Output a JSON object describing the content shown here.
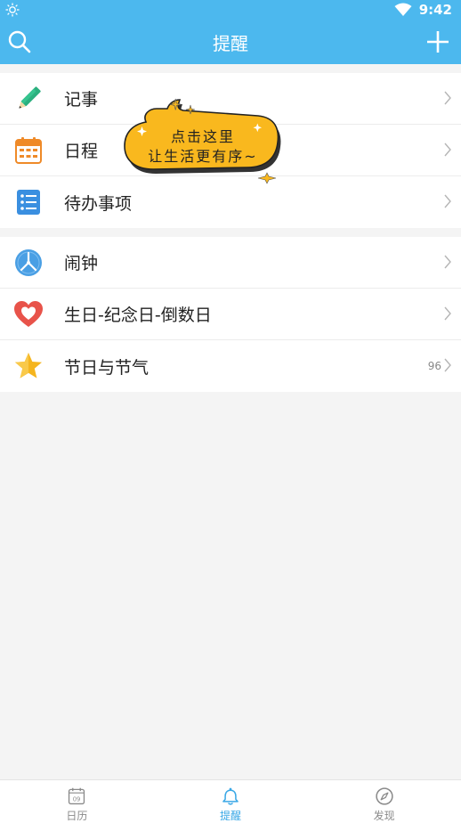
{
  "status_bar": {
    "time": "9:42"
  },
  "header": {
    "title": "提醒"
  },
  "group1": [
    {
      "label": "记事",
      "icon": "pencil-icon"
    },
    {
      "label": "日程",
      "icon": "calendar-grid-icon"
    },
    {
      "label": "待办事项",
      "icon": "checklist-icon"
    }
  ],
  "group2": [
    {
      "label": "闹钟",
      "icon": "clock-icon"
    },
    {
      "label": "生日-纪念日-倒数日",
      "icon": "heart-icon"
    },
    {
      "label": "节日与节气",
      "icon": "star-icon",
      "count": "96"
    }
  ],
  "bubble": {
    "line1": "点击这里",
    "line2": "让生活更有序~"
  },
  "bottom_nav": {
    "calendar_day": "09",
    "items": [
      {
        "label": "日历",
        "icon": "calendar-icon",
        "active": false
      },
      {
        "label": "提醒",
        "icon": "bell-icon",
        "active": true
      },
      {
        "label": "发现",
        "icon": "compass-icon",
        "active": false
      }
    ]
  },
  "colors": {
    "primary": "#4cb8ee",
    "active_tab": "#3aa8e6",
    "bubble": "#f9b81e"
  }
}
